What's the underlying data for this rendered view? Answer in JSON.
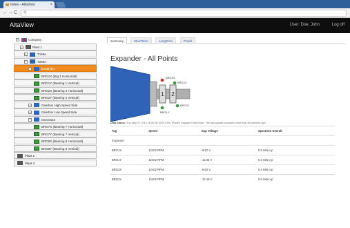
{
  "browser": {
    "tab_title": "Index - AltaView",
    "tab_close": "×",
    "back": "←",
    "forward": "→",
    "reload": "C",
    "address": ""
  },
  "header": {
    "brand": "AltaView",
    "user": "User: Doe, John",
    "logoff": "Log off"
  },
  "tree": {
    "company": "Company",
    "plant1": "Plant 1",
    "t165a": "T165a",
    "t200a": "T200A",
    "expander": "Expander",
    "brg1x": "BRG1X (Brg 1 Horizontal)",
    "brg1y": "BRG1Y (Bearing 1 Vertical)",
    "brg2x": "BRG2X (Bearing 2 Horizontal)",
    "brg2y": "BRG2Y (Bearing 2 Vertical)",
    "gearbox_high": "Gearbox High Speed Side",
    "gearbox_low": "Gearbox Low Speed Side",
    "generator": "Generator",
    "brg7x": "BRG7X (Bearing 7 Horizontal)",
    "brg7y": "BRG7Y (Bearing 7 Vertical)",
    "brg8x": "BRG8X (Bearing 8 Horizontal)",
    "brg8y": "BRG8Y (Bearing 8 Vertical)",
    "plant2": "Plant 2",
    "plant3": "Plant 3"
  },
  "tabs": [
    "Summary",
    "ShortTerm",
    "LongTerm",
    "Portal"
  ],
  "page_title": "Expander - All Points",
  "diagram": {
    "brg1x": "BRG1X",
    "brg2x": "BRG2X",
    "brg1y": "BRG1Y",
    "brg2y": "BRG2Y",
    "bearing1": "1",
    "bearing2": "2"
  },
  "status": {
    "label": "Data Status:",
    "text": "Thu May 27 2014 16:00:00 GMT-0700 (Pacific Daylight Time) Note: The last update occurred more than 60 minutes ago."
  },
  "table": {
    "headers": [
      "Tag",
      "Speed",
      "Gap Voltage",
      "Spectrum Overall"
    ],
    "group": "Expander",
    "rows": [
      [
        "BRG1X",
        "12402 RPM",
        "-9.97 V",
        "0.5 mils p-p"
      ],
      [
        "BRG1Y",
        "12402 RPM",
        "-11.85 V",
        "0.4 mils p-p"
      ],
      [
        "BRG2X",
        "12402 RPM",
        "-9.62 V",
        "0.4 mils p-p"
      ],
      [
        "BRG2Y",
        "12402 RPM",
        "-12.19 V",
        "0.6 mils p-p"
      ]
    ]
  },
  "colors": {
    "selected": "#f08c1e",
    "header_bg": "#0e0e0e",
    "machine_blue": "#2e63b8",
    "status_green": "#2e9a3a",
    "status_red": "#d22"
  }
}
